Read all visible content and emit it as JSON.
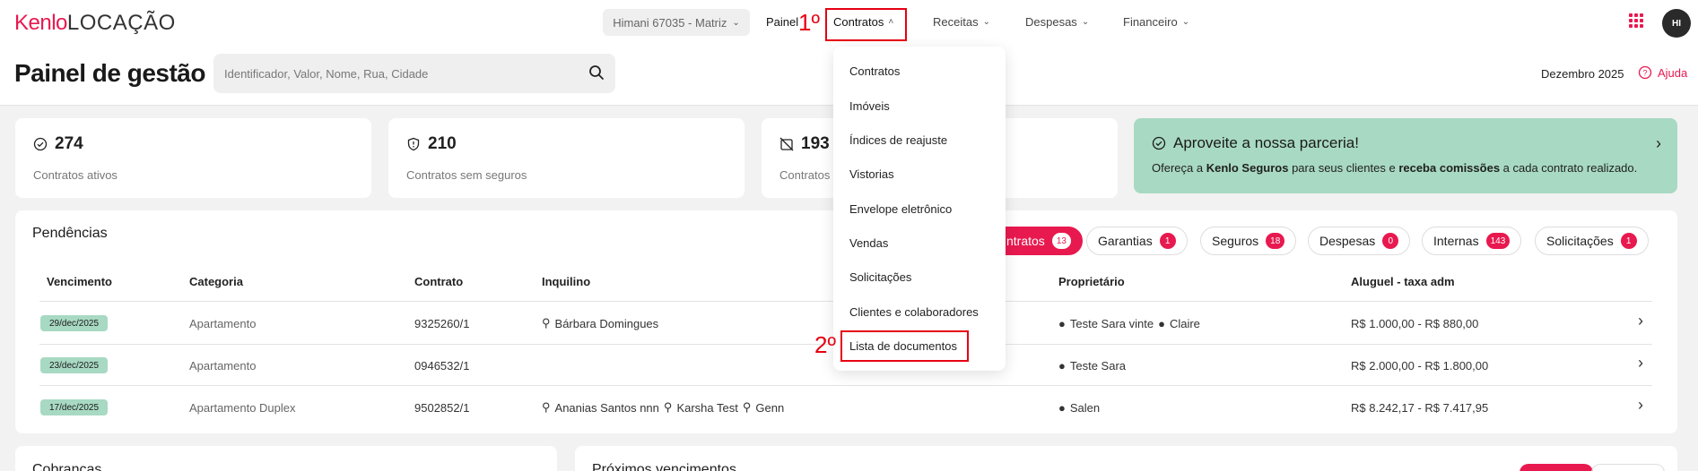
{
  "brand": {
    "logo_kenlo": "Kenlo",
    "logo_suffix": "LOCAÇÃO"
  },
  "nav": {
    "branch": "Himani 67035 - Matriz",
    "painel": "Painel",
    "contratos": "Contratos",
    "receitas": "Receitas",
    "despesas": "Despesas",
    "financeiro": "Financeiro",
    "avatar": "HI"
  },
  "annotations": {
    "step1": "1º",
    "step2": "2º"
  },
  "header": {
    "title": "Painel de gestão",
    "search_placeholder": "Identificador, Valor, Nome, Rua, Cidade",
    "month": "Dezembro 2025",
    "help": "Ajuda"
  },
  "stats": [
    {
      "value": "274",
      "label": "Contratos ativos",
      "icon": "check-circle-icon"
    },
    {
      "value": "210",
      "label": "Contratos sem seguros",
      "icon": "shield-icon"
    },
    {
      "value": "193",
      "label": "Contratos",
      "icon": "no-calendar-icon"
    }
  ],
  "promo": {
    "title": "Aproveite a nossa parceria!",
    "text_a": "Ofereça a ",
    "bold_a": "Kenlo Seguros",
    "text_b": " para seus clientes e ",
    "bold_b": "receba comissões",
    "text_c": " a cada contrato realizado."
  },
  "pendencias": {
    "title": "Pendências",
    "filters": [
      {
        "label": "ntratos",
        "count": "13"
      },
      {
        "label": "Garantias",
        "count": "1"
      },
      {
        "label": "Seguros",
        "count": "18"
      },
      {
        "label": "Despesas",
        "count": "0"
      },
      {
        "label": "Internas",
        "count": "143"
      },
      {
        "label": "Solicitações",
        "count": "1"
      }
    ],
    "columns": {
      "vencimento": "Vencimento",
      "categoria": "Categoria",
      "contrato": "Contrato",
      "inquilino": "Inquilino",
      "proprietario": "Proprietário",
      "aluguel": "Aluguel - taxa adm"
    },
    "rows": [
      {
        "date": "29/dec/2025",
        "categoria": "Apartamento",
        "contrato": "9325260/1",
        "inq1": "Bárbara Domingues",
        "inq2": "",
        "inq3": "",
        "prop1": "Teste Sara vinte",
        "prop2": "Claire",
        "aluguel": "R$ 1.000,00 - R$ 880,00"
      },
      {
        "date": "23/dec/2025",
        "categoria": "Apartamento",
        "contrato": "0946532/1",
        "inq1": "",
        "inq2": "",
        "inq3": "",
        "prop1": "Teste Sara",
        "prop2": "",
        "aluguel": "R$ 2.000,00 - R$ 1.800,00"
      },
      {
        "date": "17/dec/2025",
        "categoria": "Apartamento Duplex",
        "contrato": "9502852/1",
        "inq1": "Ananias Santos nnn",
        "inq2": "Karsha Test",
        "inq3": "Genn",
        "prop1": "Salen",
        "prop2": "",
        "aluguel": "R$ 8.242,17 - R$ 7.417,95"
      }
    ]
  },
  "bottom": {
    "cobrancas": "Cobranças",
    "proximos": "Próximos vencimentos"
  },
  "dropdown": {
    "items": [
      "Contratos",
      "Imóveis",
      "Índices de reajuste",
      "Vistorias",
      "Envelope eletrônico",
      "Vendas",
      "Solicitações",
      "Clientes e colaboradores",
      "Lista de documentos"
    ]
  },
  "colors": {
    "accent": "#e8194f",
    "promo_bg": "#a8d9c3",
    "annotation": "#e60012"
  }
}
